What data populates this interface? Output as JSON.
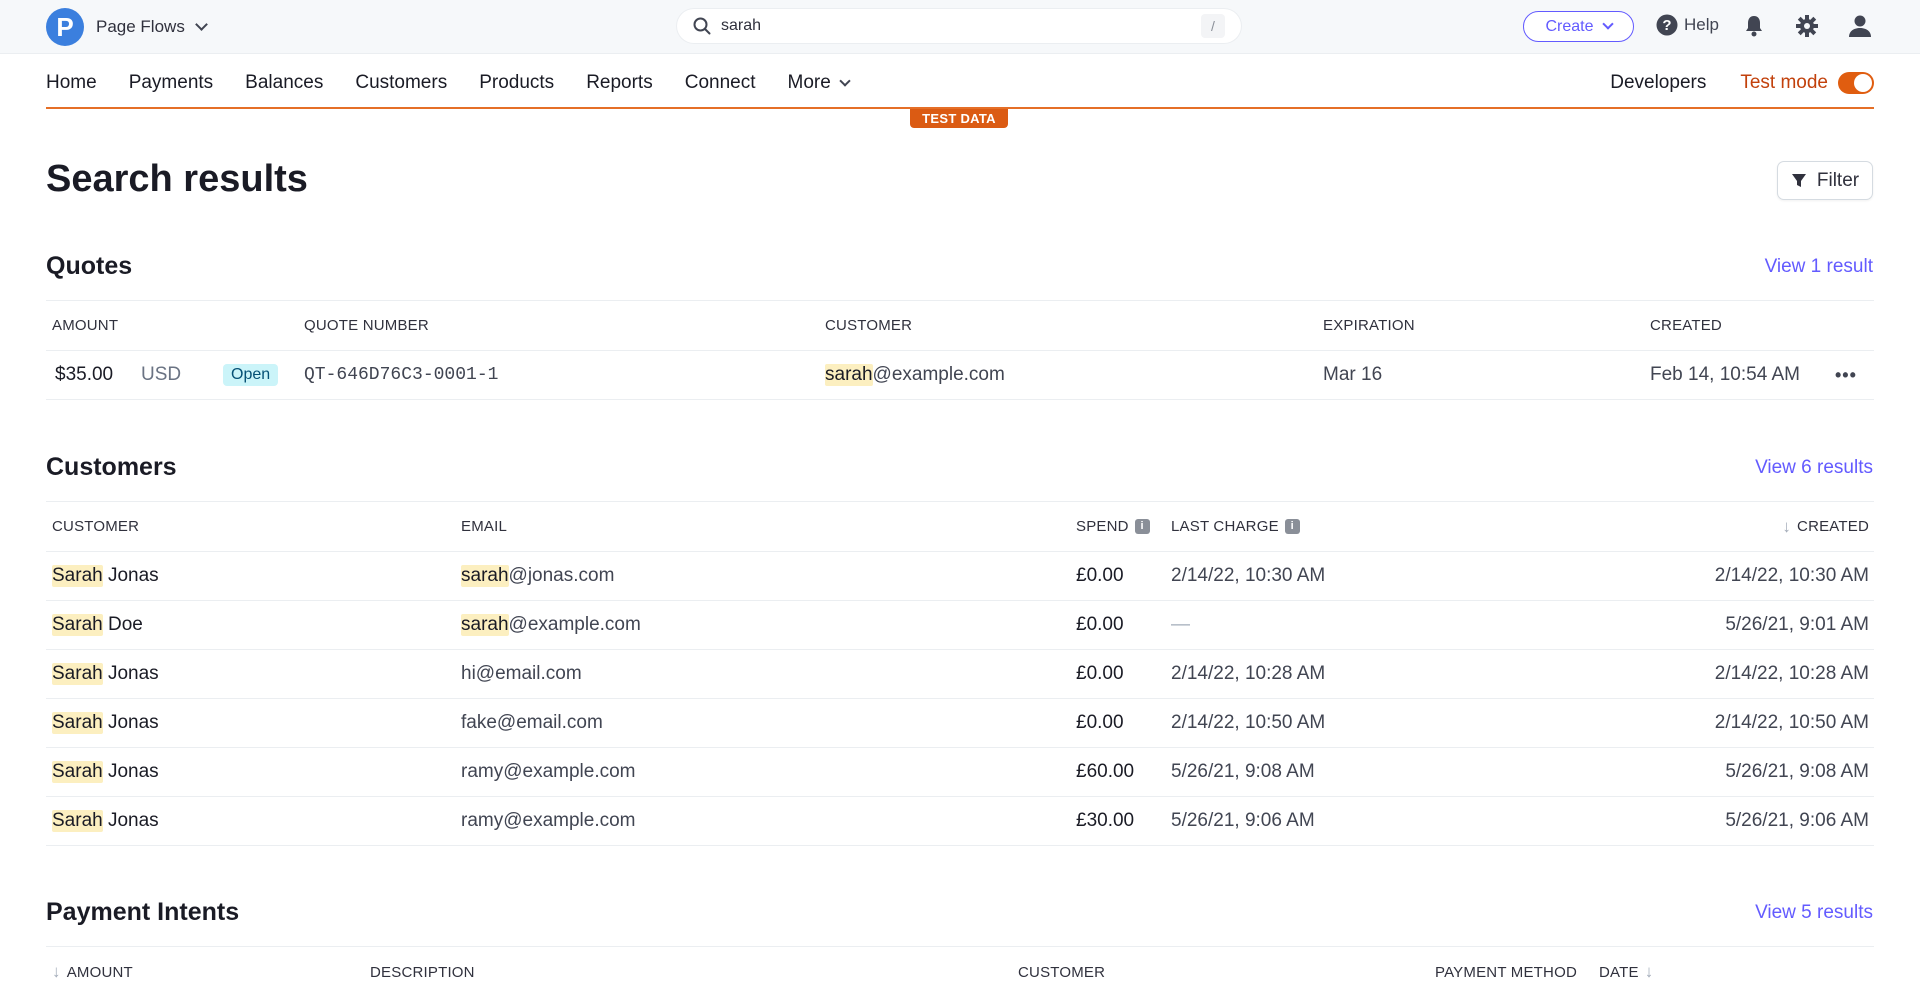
{
  "topbar": {
    "brand_initial": "P",
    "account_name": "Page Flows",
    "search": {
      "value": "sarah",
      "shortcut": "/"
    },
    "create_label": "Create",
    "help_label": "Help"
  },
  "nav": {
    "items": [
      "Home",
      "Payments",
      "Balances",
      "Customers",
      "Products",
      "Reports",
      "Connect",
      "More"
    ],
    "developers_label": "Developers",
    "test_mode_label": "Test mode",
    "test_mode_on": true,
    "test_data_badge": "TEST DATA"
  },
  "page": {
    "title": "Search results",
    "filter_label": "Filter"
  },
  "quotes": {
    "title": "Quotes",
    "view_link": "View 1 result",
    "headers": [
      "AMOUNT",
      "QUOTE NUMBER",
      "CUSTOMER",
      "EXPIRATION",
      "CREATED"
    ],
    "rows": [
      {
        "amount": "$35.00",
        "currency": "USD",
        "status": "Open",
        "quote_number": "QT-646D76C3-0001-1",
        "customer_highlight": "sarah",
        "customer_rest": "@example.com",
        "expiration": "Mar 16",
        "created": "Feb 14, 10:54 AM"
      }
    ]
  },
  "customers": {
    "title": "Customers",
    "view_link": "View 6 results",
    "headers": {
      "customer": "CUSTOMER",
      "email": "EMAIL",
      "spend": "SPEND",
      "last_charge": "LAST CHARGE",
      "created": "CREATED"
    },
    "rows": [
      {
        "name_hl": "Sarah",
        "name_rest": " Jonas",
        "email_hl": "sarah",
        "email_rest": "@jonas.com",
        "spend": "£0.00",
        "last_charge": "2/14/22, 10:30 AM",
        "created": "2/14/22, 10:30 AM"
      },
      {
        "name_hl": "Sarah",
        "name_rest": " Doe",
        "email_hl": "sarah",
        "email_rest": "@example.com",
        "spend": "£0.00",
        "last_charge": "—",
        "created": "5/26/21, 9:01 AM"
      },
      {
        "name_hl": "Sarah",
        "name_rest": " Jonas",
        "email_hl": "",
        "email_rest": "hi@email.com",
        "spend": "£0.00",
        "last_charge": "2/14/22, 10:28 AM",
        "created": "2/14/22, 10:28 AM"
      },
      {
        "name_hl": "Sarah",
        "name_rest": " Jonas",
        "email_hl": "",
        "email_rest": "fake@email.com",
        "spend": "£0.00",
        "last_charge": "2/14/22, 10:50 AM",
        "created": "2/14/22, 10:50 AM"
      },
      {
        "name_hl": "Sarah",
        "name_rest": " Jonas",
        "email_hl": "",
        "email_rest": "ramy@example.com",
        "spend": "£60.00",
        "last_charge": "5/26/21, 9:08 AM",
        "created": "5/26/21, 9:08 AM"
      },
      {
        "name_hl": "Sarah",
        "name_rest": " Jonas",
        "email_hl": "",
        "email_rest": "ramy@example.com",
        "spend": "£30.00",
        "last_charge": "5/26/21, 9:06 AM",
        "created": "5/26/21, 9:06 AM"
      }
    ]
  },
  "payment_intents": {
    "title": "Payment Intents",
    "view_link": "View 5 results",
    "headers": {
      "amount": "AMOUNT",
      "description": "DESCRIPTION",
      "customer": "CUSTOMER",
      "payment_method": "PAYMENT METHOD",
      "date": "DATE"
    }
  },
  "colors": {
    "accent": "#635bff",
    "test_mode": "#e05d10",
    "highlight": "#fcefc0",
    "badge_open_bg": "#cbf4f9"
  }
}
